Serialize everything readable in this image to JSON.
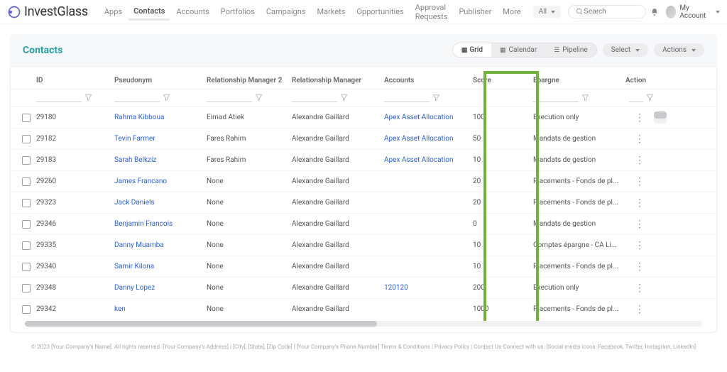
{
  "brand": "InvestGlass",
  "nav": [
    "Apps",
    "Contacts",
    "Accounts",
    "Portfolios",
    "Campaigns",
    "Markets",
    "Opportunities",
    "Approval Requests",
    "Publisher",
    "More"
  ],
  "nav_active_index": 1,
  "nav_filter": "All",
  "search": {
    "placeholder": "Search"
  },
  "account_label": "My Account",
  "page": {
    "title": "Contacts",
    "views": {
      "grid": "Grid",
      "calendar": "Calendar",
      "pipeline": "Pipeline"
    },
    "select": "Select",
    "actions": "Actions"
  },
  "columns": [
    "ID",
    "Pseudonym",
    "Relationship Manager 2",
    "Relationship Manager",
    "Accounts",
    "Score",
    "Epargne",
    "Action"
  ],
  "rows": [
    {
      "id": "29180",
      "pseudonym": "Rahma Kibboua",
      "rm2": "Eimad Atiek",
      "rm": "Alexandre Gaillard",
      "accounts": "Apex Asset Allocation",
      "accounts_link": true,
      "score": "100",
      "epargne": "Execution only"
    },
    {
      "id": "29182",
      "pseudonym": "Tevin Farmer",
      "rm2": "Fares Rahim",
      "rm": "Alexandre Gaillard",
      "accounts": "Apex Asset Allocation",
      "accounts_link": true,
      "score": "50",
      "epargne": "Mandats de gestion"
    },
    {
      "id": "29183",
      "pseudonym": "Sarah Belkziz",
      "rm2": "Fares Rahim",
      "rm": "Alexandre Gaillard",
      "accounts": "Apex Asset Allocation",
      "accounts_link": true,
      "score": "10",
      "epargne": "Mandats de gestion"
    },
    {
      "id": "29260",
      "pseudonym": "James Francano",
      "rm2": "None",
      "rm": "Alexandre Gaillard",
      "accounts": "",
      "accounts_link": false,
      "score": "20",
      "epargne": "Placements - Fonds de pl..."
    },
    {
      "id": "29323",
      "pseudonym": "Jack Daniels",
      "rm2": "None",
      "rm": "Alexandre Gaillard",
      "accounts": "",
      "accounts_link": false,
      "score": "20",
      "epargne": "Placements - Fonds de pl..."
    },
    {
      "id": "29346",
      "pseudonym": "Benjamin Francois",
      "rm2": "None",
      "rm": "Alexandre Gaillard",
      "accounts": "",
      "accounts_link": false,
      "score": "0",
      "epargne": "Mandats de gestion"
    },
    {
      "id": "29335",
      "pseudonym": "Danny Muamba",
      "rm2": "None",
      "rm": "Alexandre Gaillard",
      "accounts": "",
      "accounts_link": false,
      "score": "10",
      "epargne": "Comptes épargne - CA Li..."
    },
    {
      "id": "29340",
      "pseudonym": "Samir Kilona",
      "rm2": "None",
      "rm": "Alexandre Gaillard",
      "accounts": "",
      "accounts_link": false,
      "score": "10",
      "epargne": "Placements - Fonds de pl..."
    },
    {
      "id": "29348",
      "pseudonym": "Danny Lopez",
      "rm2": "None",
      "rm": "Alexandre Gaillard",
      "accounts": "120120",
      "accounts_link": true,
      "score": "200",
      "epargne": "Execution only"
    },
    {
      "id": "29342",
      "pseudonym": "ken",
      "rm2": "None",
      "rm": "Alexandre Gaillard",
      "accounts": "",
      "accounts_link": false,
      "score": "1000",
      "epargne": "Placements - Fonds de pl..."
    }
  ],
  "footer": "© 2023 [Your Company's Name]. All rights reserved. [Your Company's Address] | [City], [State], [Zip Code] | [Your Company's Phone Number] Terms & Conditions | Privacy Policy | Contact Us Connect with us: [Social media icons: Facebook, Twitter, Instagram, LinkedIn]"
}
